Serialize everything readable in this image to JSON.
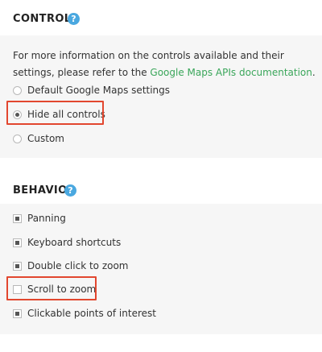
{
  "controls": {
    "title": "CONTROLS",
    "help_glyph": "?",
    "description_prefix": "For more information on the controls available and their settings, please refer to the ",
    "description_link": "Google Maps APIs documentation",
    "description_suffix": ".",
    "options": [
      {
        "label": "Default Google Maps settings",
        "checked": false
      },
      {
        "label": "Hide all controls",
        "checked": true
      },
      {
        "label": "Custom",
        "checked": false
      }
    ]
  },
  "behavior": {
    "title": "BEHAVIOR",
    "help_glyph": "?",
    "options": [
      {
        "label": "Panning",
        "checked": true
      },
      {
        "label": "Keyboard shortcuts",
        "checked": true
      },
      {
        "label": "Double click to zoom",
        "checked": true
      },
      {
        "label": "Scroll to zoom",
        "checked": false
      },
      {
        "label": "Clickable points of interest",
        "checked": true
      }
    ]
  },
  "colors": {
    "help_icon": "#4aa8e0",
    "link": "#3aa65a",
    "highlight": "#e2472f",
    "panel_bg": "#f6f6f6"
  },
  "icons": [
    "help-icon",
    "radio-button",
    "checkbox"
  ]
}
